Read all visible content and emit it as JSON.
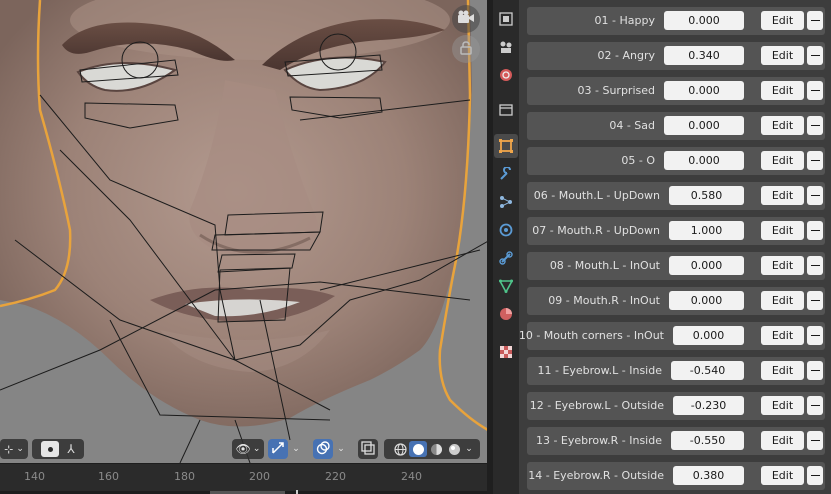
{
  "viewport": {
    "icons": {
      "camera": "camera-icon",
      "lock": "lock-icon",
      "cursor_mode": "cursor-icon",
      "pivot": "pivot-dot-icon",
      "bone": "bone-icon",
      "visibility": "eye-icon",
      "gizmo": "gizmo-icon",
      "overlays": "overlays-icon",
      "xray": "xray-icon",
      "shading_wire": "wireframe-sphere-icon",
      "shading_solid": "solid-sphere-icon",
      "shading_material": "material-sphere-icon",
      "shading_render": "render-sphere-icon"
    },
    "colors": {
      "selection_outline": "#e8a33c",
      "active_toggle": "#4772b3"
    }
  },
  "timeline": {
    "ticks": [
      "140",
      "160",
      "180",
      "200",
      "220",
      "240"
    ]
  },
  "properties_tabs": [
    {
      "name": "render-icon",
      "active": false
    },
    {
      "name": "output-icon",
      "active": false
    },
    {
      "name": "view-layer-icon",
      "active": false
    },
    {
      "name": "scene-icon",
      "active": false
    },
    {
      "name": "object-icon",
      "active": true
    },
    {
      "name": "modifier-icon",
      "active": false
    },
    {
      "name": "particles-icon",
      "active": false
    },
    {
      "name": "physics-icon",
      "active": false
    },
    {
      "name": "constraints-icon",
      "active": false
    },
    {
      "name": "object-data-icon",
      "active": false
    },
    {
      "name": "material-icon",
      "active": false
    },
    {
      "name": "texture-icon",
      "active": false
    }
  ],
  "shape_keys": [
    {
      "label": "01 - Happy",
      "value": "0.000",
      "edit": "Edit"
    },
    {
      "label": "02 - Angry",
      "value": "0.340",
      "edit": "Edit"
    },
    {
      "label": "03 - Surprised",
      "value": "0.000",
      "edit": "Edit"
    },
    {
      "label": "04 - Sad",
      "value": "0.000",
      "edit": "Edit"
    },
    {
      "label": "05 - O",
      "value": "0.000",
      "edit": "Edit"
    },
    {
      "label": "06 - Mouth.L - UpDown",
      "value": "0.580",
      "edit": "Edit"
    },
    {
      "label": "07 - Mouth.R - UpDown",
      "value": "1.000",
      "edit": "Edit"
    },
    {
      "label": "08 - Mouth.L - InOut",
      "value": "0.000",
      "edit": "Edit"
    },
    {
      "label": "09 - Mouth.R - InOut",
      "value": "0.000",
      "edit": "Edit"
    },
    {
      "label": "10 - Mouth corners - InOut",
      "value": "0.000",
      "edit": "Edit"
    },
    {
      "label": "11 - Eyebrow.L - Inside",
      "value": "-0.540",
      "edit": "Edit"
    },
    {
      "label": "12 - Eyebrow.L - Outside",
      "value": "-0.230",
      "edit": "Edit"
    },
    {
      "label": "13 - Eyebrow.R - Inside",
      "value": "-0.550",
      "edit": "Edit"
    },
    {
      "label": "14 - Eyebrow.R - Outside",
      "value": "0.380",
      "edit": "Edit"
    }
  ]
}
